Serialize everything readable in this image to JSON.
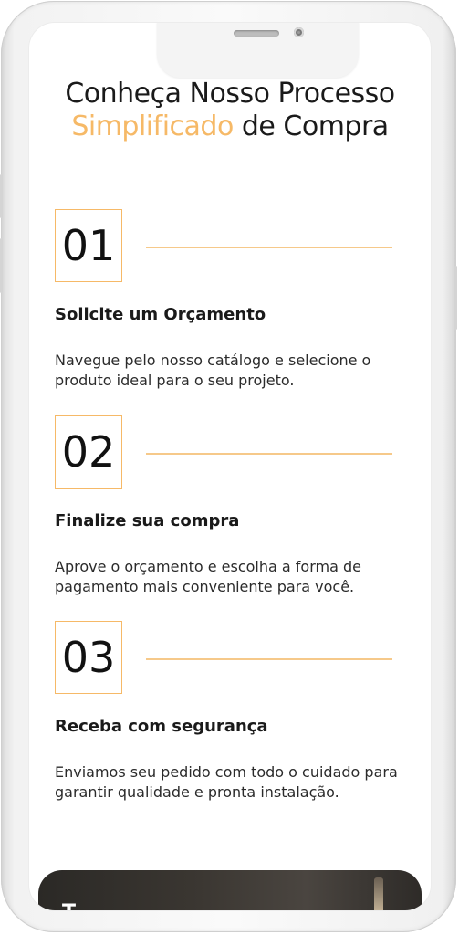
{
  "header": {
    "title_line1": "Conheça Nosso Processo",
    "title_accent": "Simplificado",
    "title_rest": "de Compra"
  },
  "steps": [
    {
      "number": "01",
      "title": "Solicite um Orçamento",
      "description": "Navegue pelo nosso catálogo e selecione o produto ideal para o seu projeto."
    },
    {
      "number": "02",
      "title": "Finalize sua compra",
      "description": "Aprove o orçamento e escolha a forma de pagamento mais conveniente para você."
    },
    {
      "number": "03",
      "title": "Receba com segurança",
      "description": "Enviamos seu pedido com todo o cuidado para garantir qualidade e pronta instalação."
    }
  ],
  "footer_preview": {
    "text": "T"
  },
  "colors": {
    "accent": "#f6b967",
    "text": "#1a1a1a"
  }
}
